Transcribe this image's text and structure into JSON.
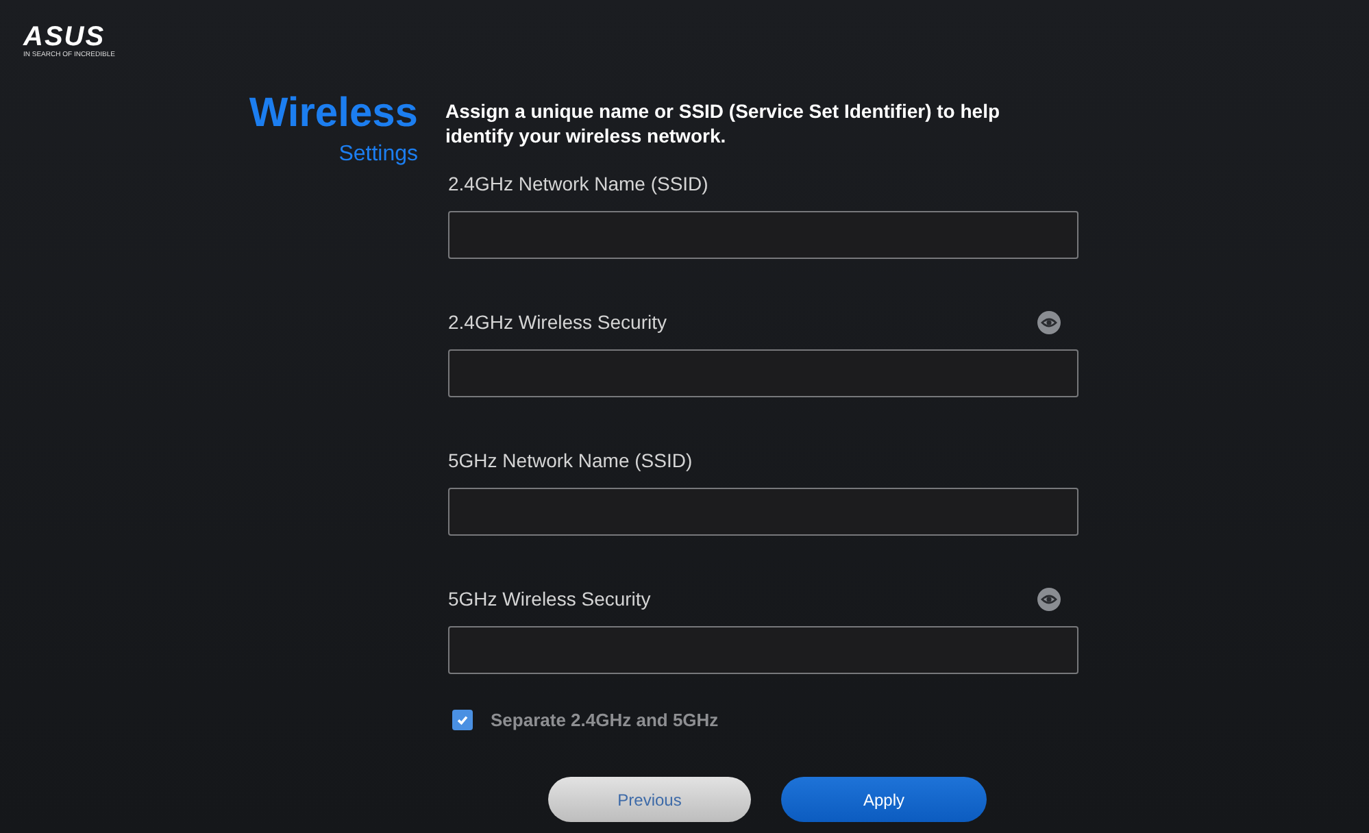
{
  "logo": {
    "wordmark": "ASUS",
    "tagline": "IN SEARCH OF INCREDIBLE"
  },
  "heading": {
    "title": "Wireless",
    "subtitle": "Settings"
  },
  "intro": "Assign a unique name or SSID (Service Set Identifier) to help identify your wireless network.",
  "fields": [
    {
      "label": "2.4GHz Network Name (SSID)",
      "kind": "text"
    },
    {
      "label": "2.4GHz Wireless Security",
      "kind": "password"
    },
    {
      "label": "5GHz Network Name (SSID)",
      "kind": "text"
    },
    {
      "label": "5GHz Wireless Security",
      "kind": "password"
    }
  ],
  "separate": {
    "label": "Separate 2.4GHz and 5GHz",
    "checked": true
  },
  "buttons": [
    {
      "label": "Previous",
      "kind": "secondary"
    },
    {
      "label": "Apply",
      "kind": "primary"
    }
  ]
}
